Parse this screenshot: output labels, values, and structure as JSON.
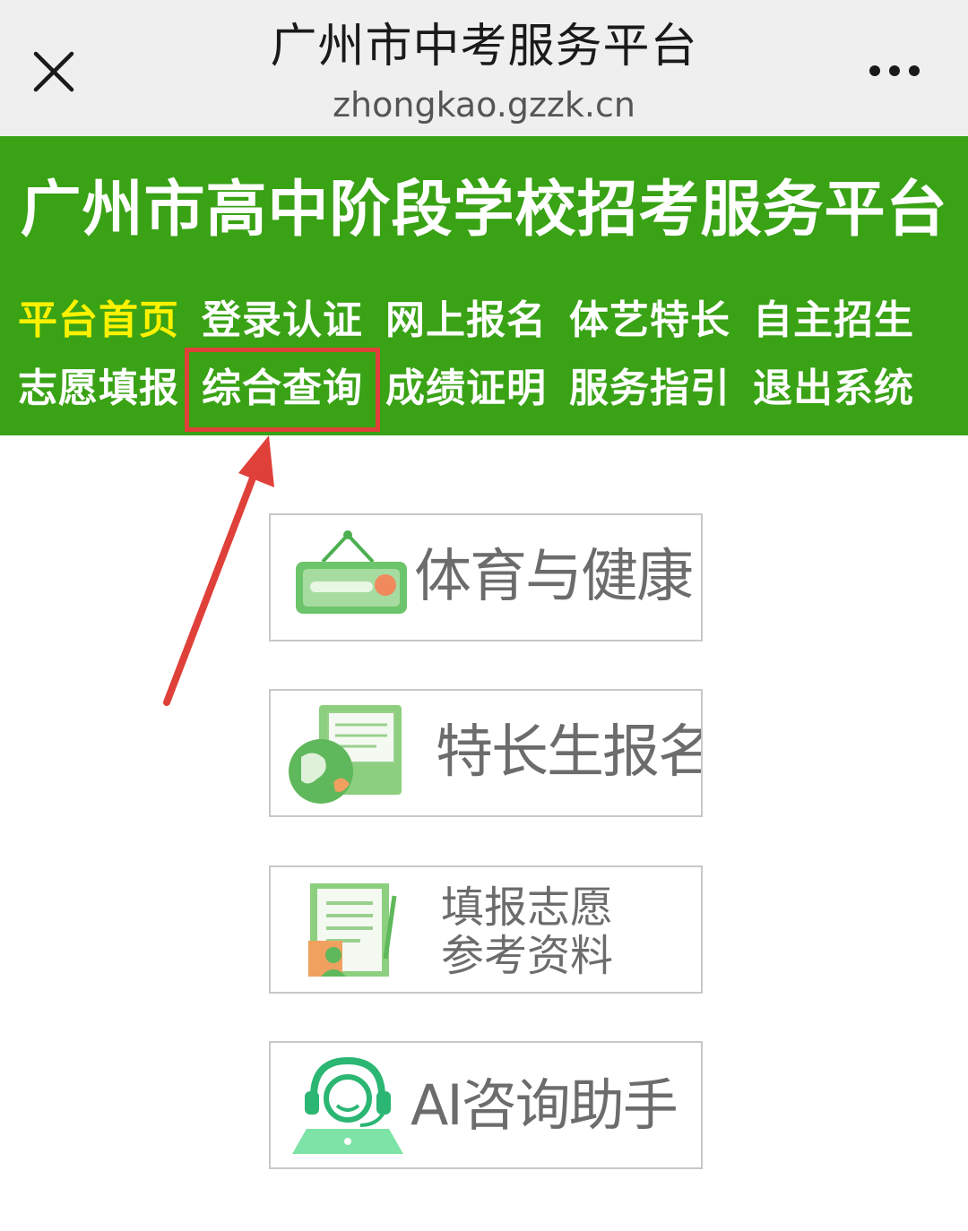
{
  "browser": {
    "title": "广州市中考服务平台",
    "url": "zhongkao.gzzk.cn"
  },
  "header": {
    "title": "广州市高中阶段学校招考服务平台",
    "nav": [
      {
        "label": "平台首页",
        "active": true
      },
      {
        "label": "登录认证"
      },
      {
        "label": "网上报名"
      },
      {
        "label": "体艺特长"
      },
      {
        "label": "自主招生"
      },
      {
        "label": "志愿填报"
      },
      {
        "label": "综合查询",
        "highlighted": true
      },
      {
        "label": "成绩证明"
      },
      {
        "label": "服务指引"
      },
      {
        "label": "退出系统"
      }
    ]
  },
  "cards": [
    {
      "label": "体育与健康",
      "icon": "signboard-icon"
    },
    {
      "label": "特长生报名",
      "icon": "globe-folder-icon"
    },
    {
      "line1": "填报志愿",
      "line2": "参考资料",
      "icon": "document-person-icon"
    },
    {
      "label": "AI咨询助手",
      "icon": "headset-assistant-icon"
    }
  ],
  "colors": {
    "header_green": "#39a215",
    "active_nav": "#fff200",
    "highlight_red": "#e0403a"
  }
}
